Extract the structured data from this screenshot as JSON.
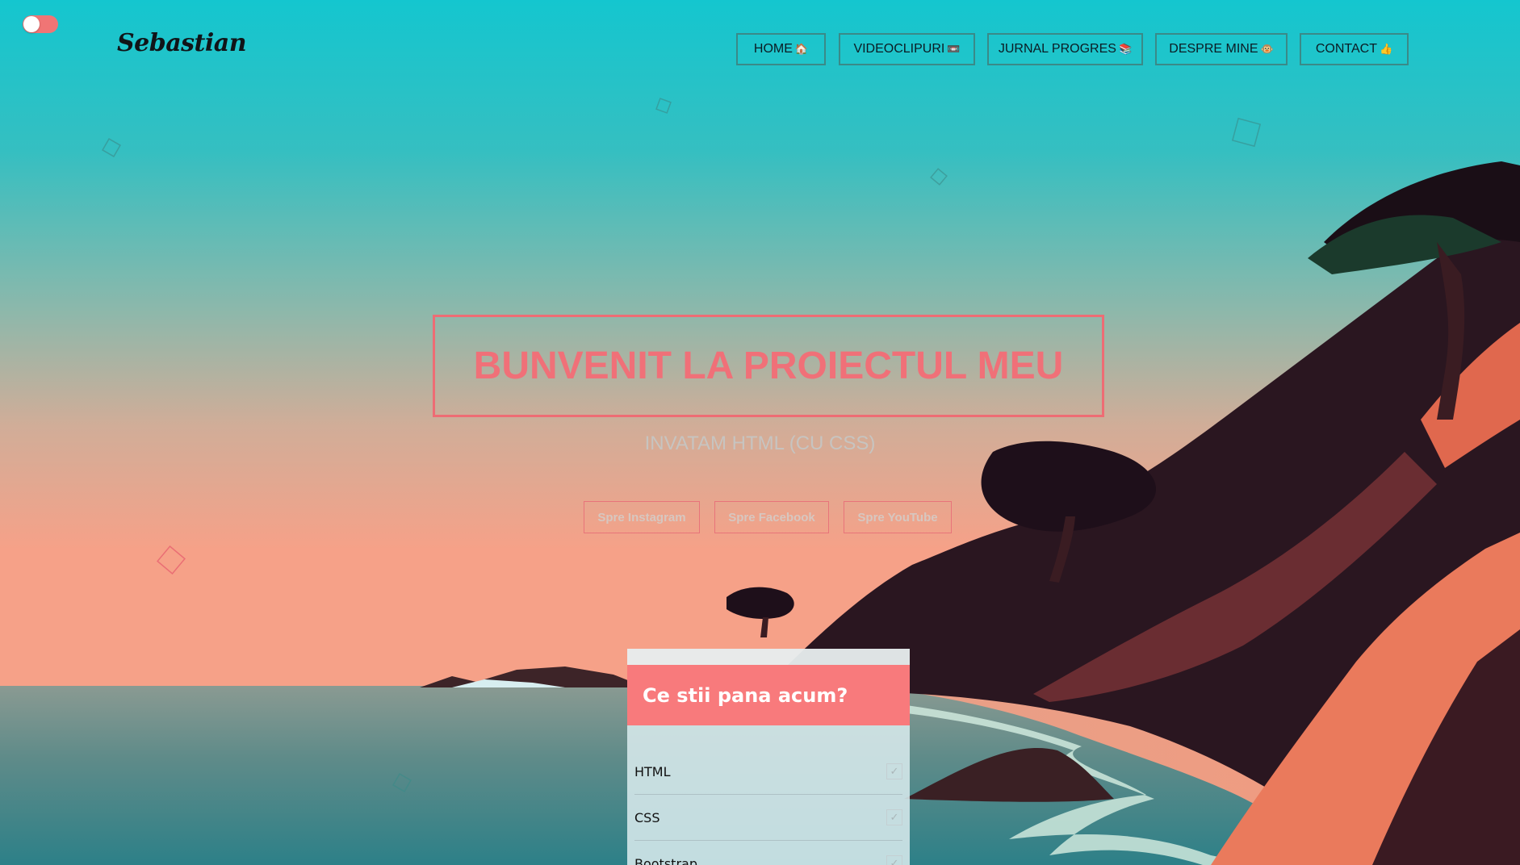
{
  "theme_toggle": {
    "state": "off",
    "track_color": "#f07575"
  },
  "logo": {
    "text": "Sebastian"
  },
  "nav": {
    "items": [
      {
        "label": "HOME",
        "icon": "🏠",
        "icon_name": "house-icon"
      },
      {
        "label": "VIDEOCLIPURI",
        "icon": "📼",
        "icon_name": "videotape-icon"
      },
      {
        "label": "JURNAL PROGRES",
        "icon": "📚",
        "icon_name": "books-icon"
      },
      {
        "label": "DESPRE MINE",
        "icon": "🐵",
        "icon_name": "monkey-face-icon"
      },
      {
        "label": "CONTACT",
        "icon": "👍",
        "icon_name": "thumbs-up-icon"
      }
    ]
  },
  "hero": {
    "title": "BUNVENIT LA PROIECTUL MEU",
    "subtitle": "INVATAM HTML (CU CSS)",
    "buttons": [
      {
        "label": "Spre Instagram"
      },
      {
        "label": "Spre Facebook"
      },
      {
        "label": "Spre YouTube"
      }
    ]
  },
  "skills_card": {
    "title": "Ce stii pana acum?",
    "items": [
      {
        "label": "HTML",
        "checked": true
      },
      {
        "label": "CSS",
        "checked": true
      },
      {
        "label": "Bootstrap",
        "checked": true
      }
    ]
  },
  "colors": {
    "accent": "#f07078",
    "sky_top": "#14c6cf",
    "horizon": "#f2a388",
    "nav_border": "#3a8a88"
  }
}
